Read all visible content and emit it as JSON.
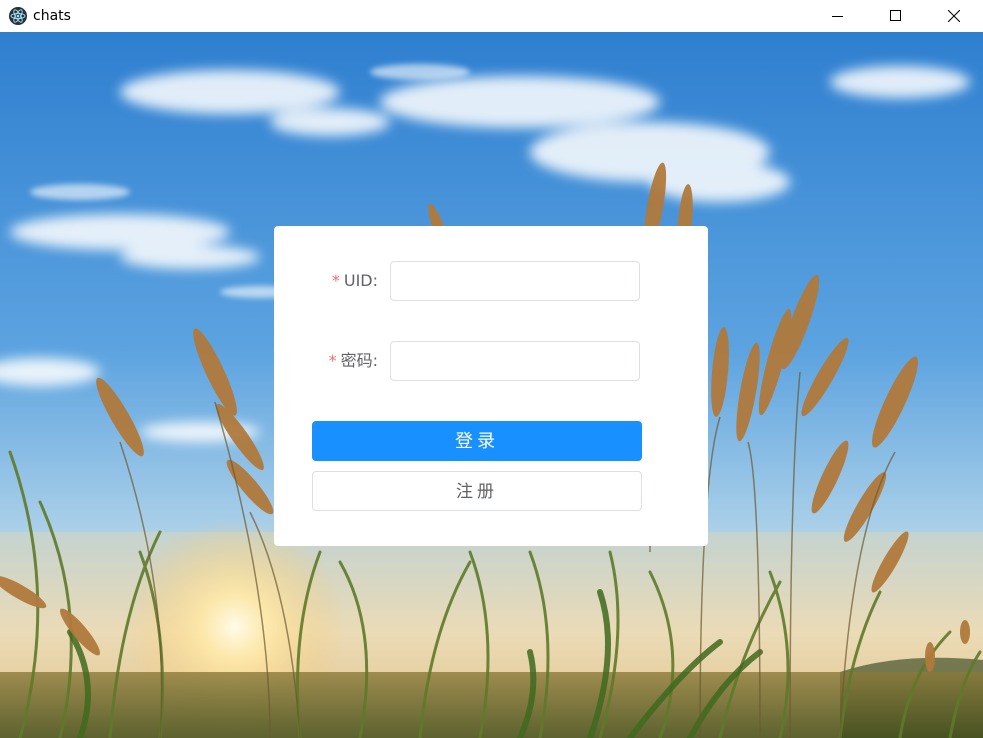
{
  "window": {
    "title": "chats",
    "icon": "electron-icon"
  },
  "colors": {
    "primary": "#1890ff",
    "required": "#f56c6c",
    "label": "#606266",
    "border": "#dcdfe6"
  },
  "form": {
    "uid": {
      "required_mark": "*",
      "label": "UID:",
      "value": ""
    },
    "password": {
      "required_mark": "*",
      "label": "密码:",
      "value": ""
    },
    "login_button": "登录",
    "register_button": "注册"
  }
}
